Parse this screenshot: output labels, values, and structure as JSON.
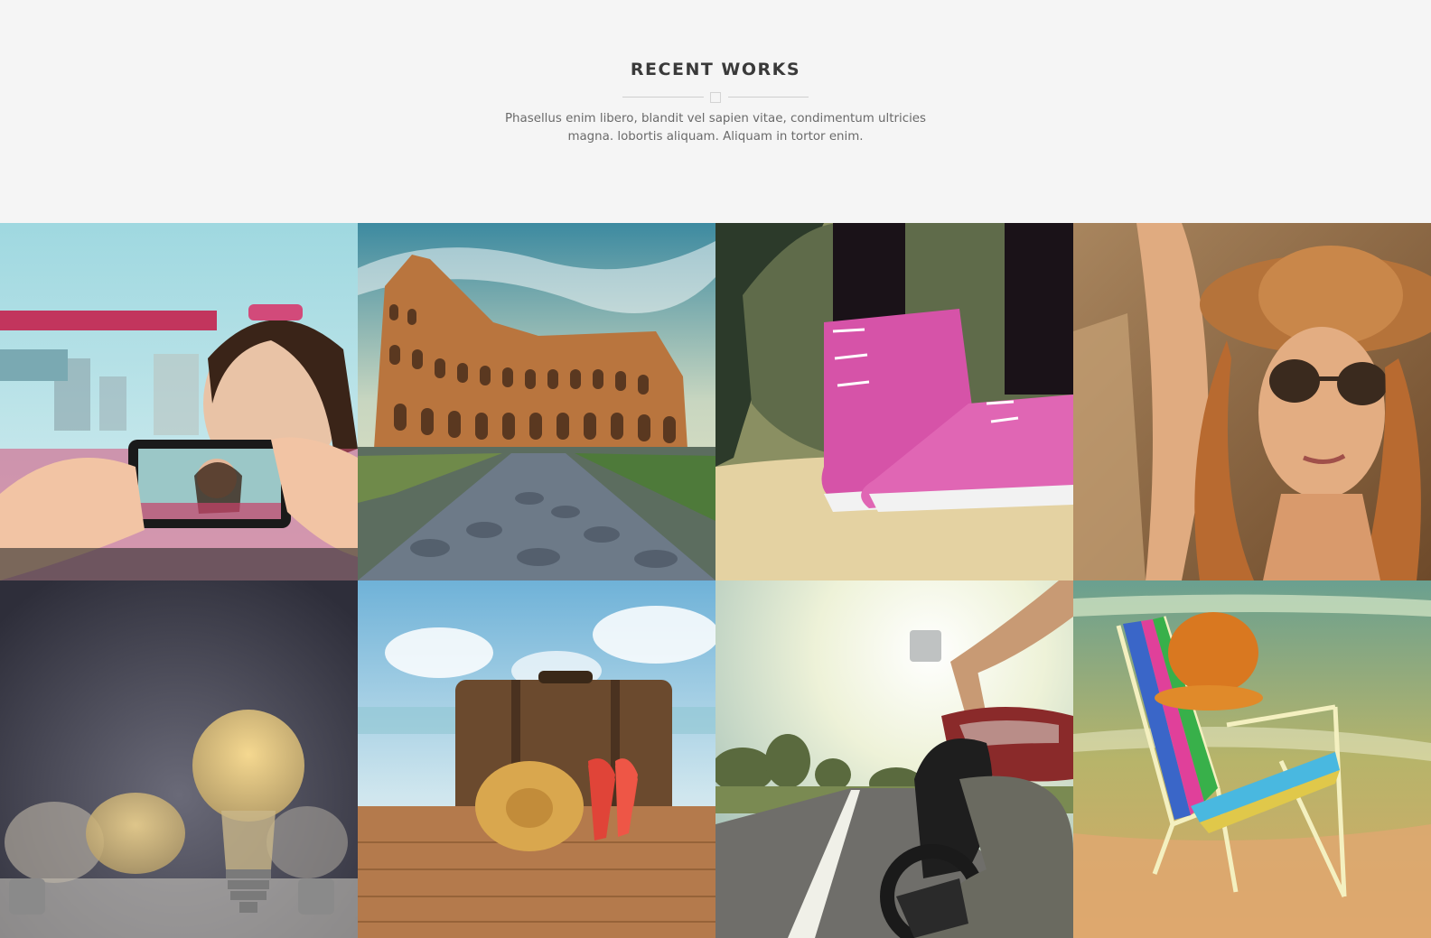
{
  "section": {
    "title": "RECENT WORKS",
    "subtitle": "Phasellus enim libero, blandit vel sapien vitae, condimentum ultricies magna. lobortis aliquam. Aliquam in tortor enim."
  },
  "portfolio": {
    "items": [
      {
        "icon": "selfie-phone-photo"
      },
      {
        "icon": "colosseum-photo"
      },
      {
        "icon": "pink-sneakers-photo"
      },
      {
        "icon": "woman-sunhat-photo"
      },
      {
        "icon": "light-bulbs-photo"
      },
      {
        "icon": "suitcase-beach-photo"
      },
      {
        "icon": "motorcycle-road-photo"
      },
      {
        "icon": "beach-chair-photo"
      }
    ]
  },
  "colors": {
    "background": "#f5f5f5",
    "title": "#3a3a3a",
    "text": "#6a6a6a",
    "divider": "#cfcfcf"
  }
}
